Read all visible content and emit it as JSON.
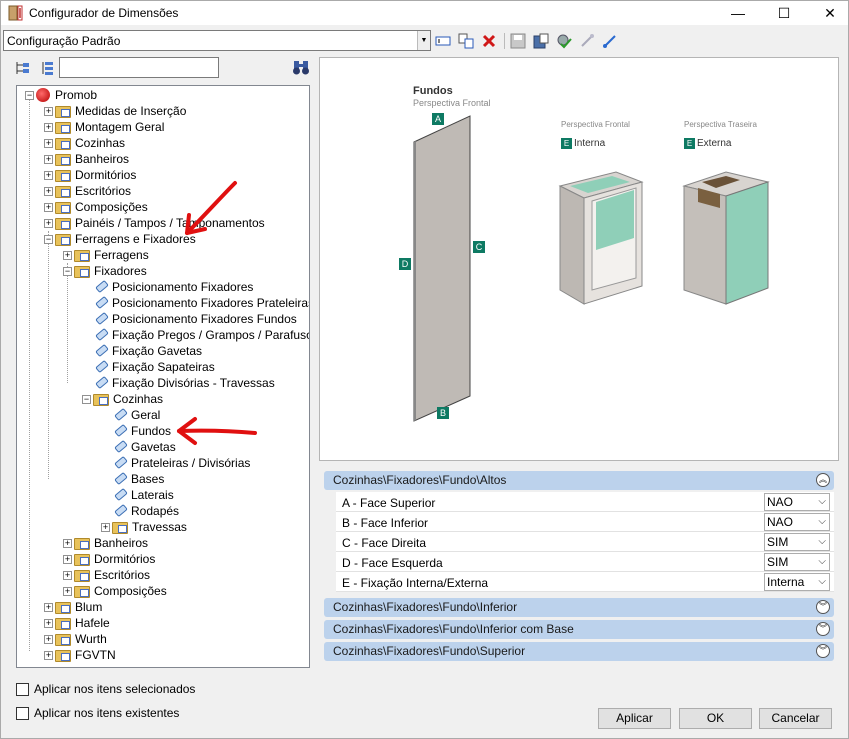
{
  "window": {
    "title": "Configurador de Dimensões",
    "minimize": "—",
    "maximize": "☐",
    "close": "✕"
  },
  "toolbar": {
    "config_value": "Configuração Padrão"
  },
  "tree": {
    "search_value": "",
    "nodes": [
      {
        "label": "Promob"
      },
      {
        "label": "Medidas de Inserção"
      },
      {
        "label": "Montagem Geral"
      },
      {
        "label": "Cozinhas"
      },
      {
        "label": "Banheiros"
      },
      {
        "label": "Dormitórios"
      },
      {
        "label": "Escritórios"
      },
      {
        "label": "Composições"
      },
      {
        "label": "Painéis / Tampos / Tamponamentos"
      },
      {
        "label": "Ferragens e Fixadores"
      },
      {
        "label": "Ferragens"
      },
      {
        "label": "Fixadores"
      },
      {
        "label": "Posicionamento Fixadores"
      },
      {
        "label": "Posicionamento Fixadores Prateleiras"
      },
      {
        "label": "Posicionamento Fixadores Fundos"
      },
      {
        "label": "Fixação Pregos / Grampos / Parafusos"
      },
      {
        "label": "Fixação Gavetas"
      },
      {
        "label": "Fixação Sapateiras"
      },
      {
        "label": "Fixação Divisórias - Travessas"
      },
      {
        "label": "Cozinhas"
      },
      {
        "label": "Geral"
      },
      {
        "label": "Fundos"
      },
      {
        "label": "Gavetas"
      },
      {
        "label": "Prateleiras / Divisórias"
      },
      {
        "label": "Bases"
      },
      {
        "label": "Laterais"
      },
      {
        "label": "Rodapés"
      },
      {
        "label": "Travessas"
      },
      {
        "label": "Banheiros"
      },
      {
        "label": "Dormitórios"
      },
      {
        "label": "Escritórios"
      },
      {
        "label": "Composições"
      },
      {
        "label": "Blum"
      },
      {
        "label": "Hafele"
      },
      {
        "label": "Wurth"
      },
      {
        "label": "FGVTN"
      }
    ]
  },
  "preview": {
    "title": "Fundos",
    "subtitle": "Perspectiva Frontal",
    "marker_a": "A",
    "marker_b": "B",
    "marker_c": "C",
    "marker_d": "D",
    "marker_e": "E",
    "left_caption": "Perspectiva Frontal",
    "left_label": "Interna",
    "right_caption": "Perspectiva Traseira",
    "right_label": "Externa"
  },
  "properties": {
    "sections": [
      {
        "title": "Cozinhas\\Fixadores\\Fundo\\Altos",
        "chev": "︽"
      },
      {
        "title": "Cozinhas\\Fixadores\\Fundo\\Inferior",
        "chev": "︾"
      },
      {
        "title": "Cozinhas\\Fixadores\\Fundo\\Inferior com Base",
        "chev": "︾"
      },
      {
        "title": "Cozinhas\\Fixadores\\Fundo\\Superior",
        "chev": "︾"
      }
    ],
    "rows": [
      {
        "label": "A - Face Superior",
        "value": "NAO"
      },
      {
        "label": "B - Face Inferior",
        "value": "NAO"
      },
      {
        "label": "C - Face Direita",
        "value": "SIM"
      },
      {
        "label": "D - Face Esquerda",
        "value": "SIM"
      },
      {
        "label": "E - Fixação Interna/Externa",
        "value": "Interna"
      }
    ]
  },
  "options": {
    "apply_selected": "Aplicar nos itens selecionados",
    "apply_existing": "Aplicar nos itens existentes"
  },
  "buttons": {
    "apply": "Aplicar",
    "ok": "OK",
    "cancel": "Cancelar"
  },
  "colors": {
    "accent_marker": "#0e7a63",
    "section_header": "#bcd2ec",
    "annotation_arrow": "#e01010"
  }
}
